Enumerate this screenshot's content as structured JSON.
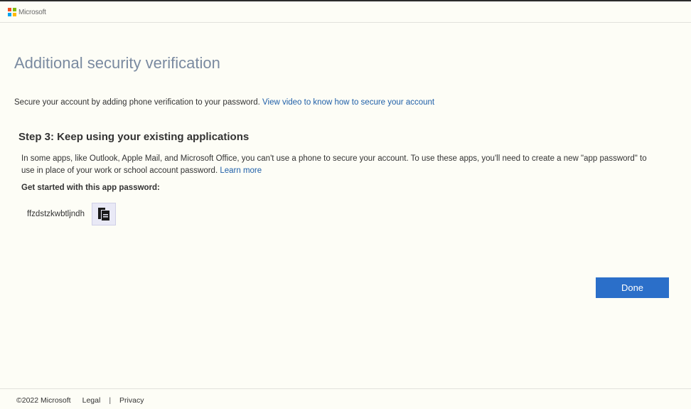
{
  "brand": {
    "name": "Microsoft",
    "logo_colors": [
      "#f25022",
      "#7fba00",
      "#00a4ef",
      "#ffb900"
    ]
  },
  "page": {
    "title": "Additional security verification",
    "intro_text": "Secure your account by adding phone verification to your password.",
    "intro_link": "View video to know how to secure your account"
  },
  "step": {
    "title": "Step 3: Keep using your existing applications",
    "description": "In some apps, like Outlook, Apple Mail, and Microsoft Office, you can't use a phone to secure your account. To use these apps, you'll need to create a new \"app password\" to use in place of your work or school account password.",
    "learn_more": "Learn more",
    "get_started_label": "Get started with this app password:",
    "app_password": "ffzdstzkwbtljndh"
  },
  "actions": {
    "done_label": "Done"
  },
  "footer": {
    "copyright": "©2022 Microsoft",
    "legal": "Legal",
    "separator": "|",
    "privacy": "Privacy"
  },
  "colors": {
    "accent": "#2b6fc9",
    "link": "#1f5fa8",
    "title": "#7a8aa0",
    "background": "#fdfdf6"
  },
  "icons": {
    "copy": "copy-icon",
    "logo": "microsoft-logo-icon"
  }
}
